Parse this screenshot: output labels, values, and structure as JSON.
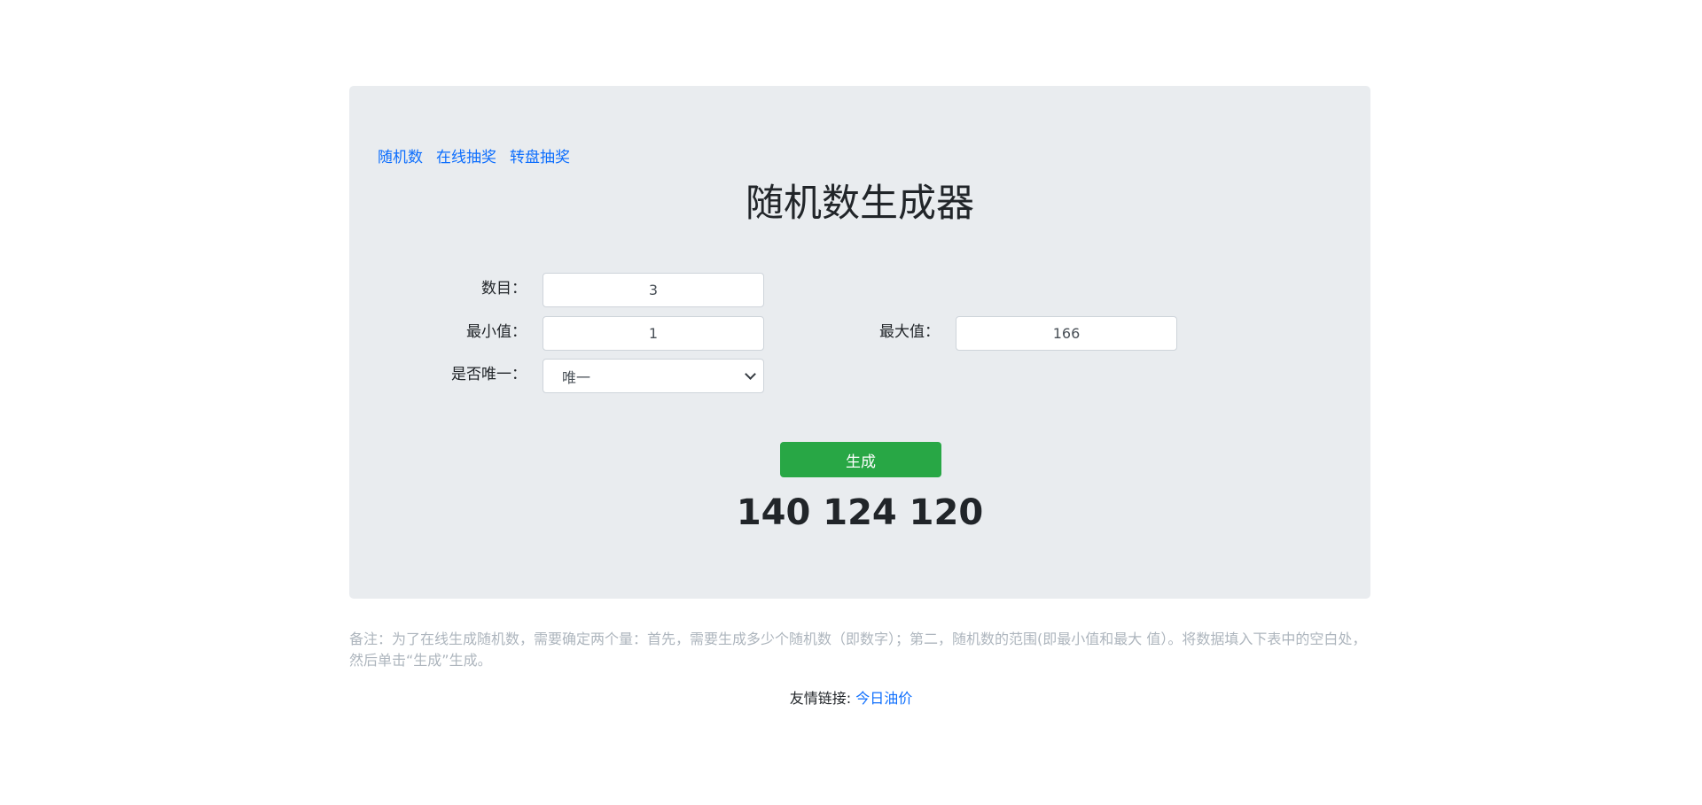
{
  "nav": {
    "items": [
      {
        "label": "随机数"
      },
      {
        "label": "在线抽奖"
      },
      {
        "label": "转盘抽奖"
      }
    ]
  },
  "page_title": "随机数生成器",
  "form": {
    "count_label": "数目：",
    "count_value": "3",
    "min_label": "最小值：",
    "min_value": "1",
    "max_label": "最大值：",
    "max_value": "166",
    "unique_label": "是否唯一：",
    "unique_selected": "唯一"
  },
  "generate_button": "生成",
  "result": "140 124 120",
  "note": "备注：为了在线生成随机数，需要确定两个量：首先，需要生成多少个随机数（即数字）；第二，随机数的范围(即最小值和最大 值）。将数据填入下表中的空白处，然后单击“生成”生成。",
  "footer": {
    "friend_links_label": "友情链接:",
    "friend_link": "今日油价"
  }
}
